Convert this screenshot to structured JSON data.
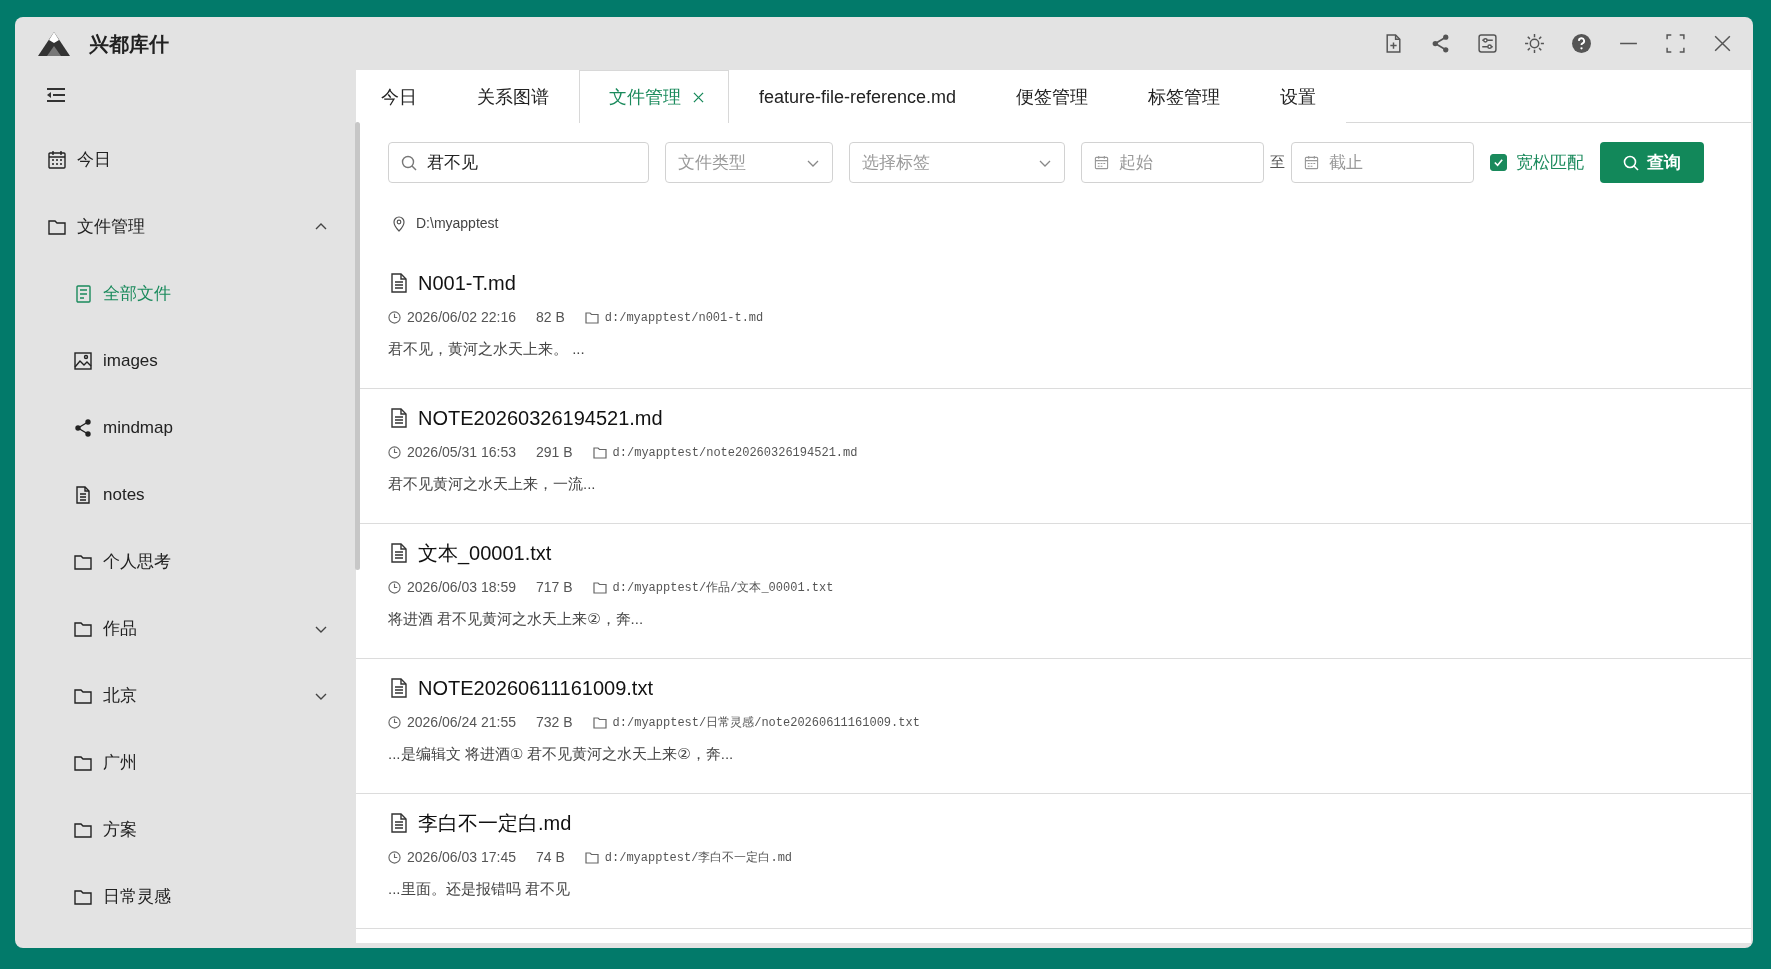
{
  "window": {
    "title": "兴都库什"
  },
  "sidebar": {
    "items": [
      {
        "label": "今日",
        "kind": "calendar",
        "selected": false
      },
      {
        "label": "文件管理",
        "kind": "folder",
        "selected": false,
        "expanded": true,
        "children": [
          {
            "label": "全部文件",
            "kind": "list",
            "selected": true
          },
          {
            "label": "images",
            "kind": "image",
            "selected": false
          },
          {
            "label": "mindmap",
            "kind": "share",
            "selected": false
          },
          {
            "label": "notes",
            "kind": "file",
            "selected": false
          },
          {
            "label": "个人思考",
            "kind": "folder",
            "selected": false
          },
          {
            "label": "作品",
            "kind": "folder",
            "selected": false,
            "expanded": false
          },
          {
            "label": "北京",
            "kind": "folder",
            "selected": false,
            "expanded": false
          },
          {
            "label": "广州",
            "kind": "folder",
            "selected": false
          },
          {
            "label": "方案",
            "kind": "folder",
            "selected": false
          },
          {
            "label": "日常灵感",
            "kind": "folder",
            "selected": false
          }
        ]
      }
    ]
  },
  "tabs": [
    {
      "label": "今日",
      "selected": false
    },
    {
      "label": "关系图谱",
      "selected": false
    },
    {
      "label": "文件管理",
      "selected": true
    },
    {
      "label": "feature-file-reference.md",
      "selected": false
    },
    {
      "label": "便签管理",
      "selected": false
    },
    {
      "label": "标签管理",
      "selected": false
    },
    {
      "label": "设置",
      "selected": false
    }
  ],
  "filters": {
    "query": "君不见",
    "file_type": {
      "placeholder": "文件类型"
    },
    "tags": {
      "placeholder": "选择标签"
    },
    "start": {
      "placeholder": "起始"
    },
    "range_separator": "至",
    "end": {
      "placeholder": "截止"
    },
    "loose_match": {
      "label": "宽松匹配",
      "checked": true
    },
    "search_button": "查询"
  },
  "location": "D:\\myapptest",
  "results": [
    {
      "name": "N001-T.md",
      "time": "2026/06/02 22:16",
      "size": "82 B",
      "path": "d:/myapptest/n001-t.md",
      "snippet": "君不见，黄河之水天上来。 ..."
    },
    {
      "name": "NOTE20260326194521.md",
      "time": "2026/05/31 16:53",
      "size": "291 B",
      "path": "d:/myapptest/note20260326194521.md",
      "snippet": "君不见黄河之水天上来，一流..."
    },
    {
      "name": "文本_00001.txt",
      "time": "2026/06/03 18:59",
      "size": "717 B",
      "path": "d:/myapptest/作品/文本_00001.txt",
      "snippet": "将进酒 君不见黄河之水天上来②，奔..."
    },
    {
      "name": "NOTE20260611161009.txt",
      "time": "2026/06/24 21:55",
      "size": "732 B",
      "path": "d:/myapptest/日常灵感/note20260611161009.txt",
      "snippet": "...是编辑文 将进酒① 君不见黄河之水天上来②，奔..."
    },
    {
      "name": "李白不一定白.md",
      "time": "2026/06/03 17:45",
      "size": "74 B",
      "path": "d:/myapptest/李白不一定白.md",
      "snippet": "...里面。还是报错吗 君不见"
    }
  ]
}
